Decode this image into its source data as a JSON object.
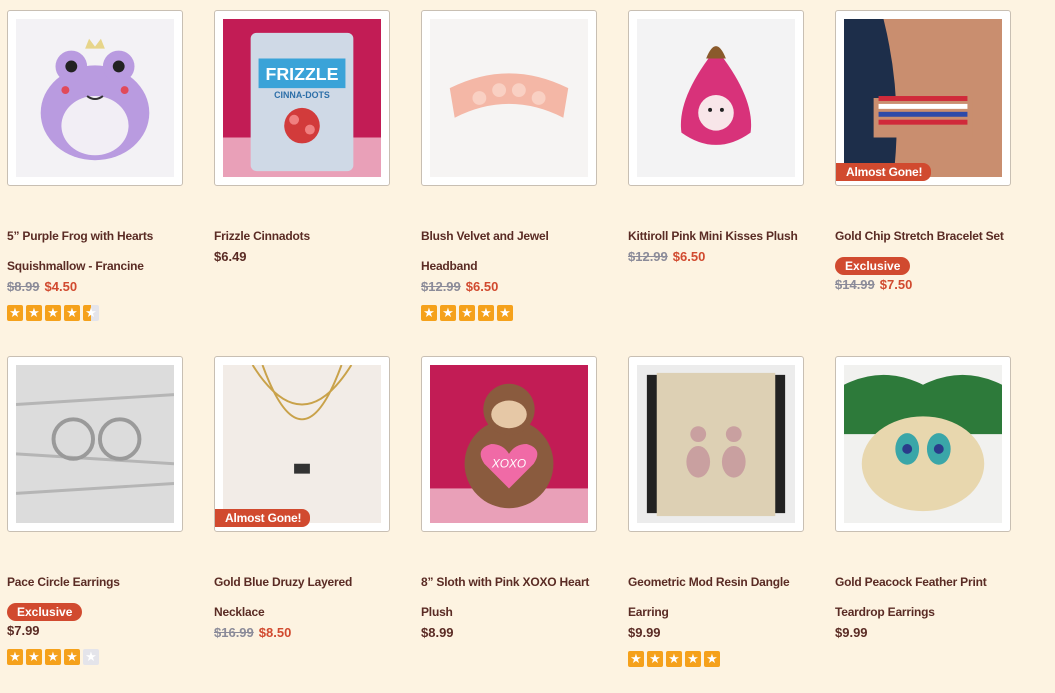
{
  "products": [
    {
      "name_lines": [
        "5” Purple Frog with Hearts",
        "Squishmallow - Francine"
      ],
      "old_price": "$8.99",
      "price": "$4.50",
      "rating": 4.5,
      "badge": "",
      "exclusive": ""
    },
    {
      "name_lines": [
        "Frizzle Cinnadots"
      ],
      "old_price": "",
      "price": "$6.49",
      "rating": 0,
      "badge": "",
      "exclusive": ""
    },
    {
      "name_lines": [
        "Blush Velvet and Jewel",
        "Headband"
      ],
      "old_price": "$12.99",
      "price": "$6.50",
      "rating": 5,
      "badge": "",
      "exclusive": ""
    },
    {
      "name_lines": [
        "Kittiroll Pink Mini Kisses Plush"
      ],
      "old_price": "$12.99",
      "price": "$6.50",
      "rating": 0,
      "badge": "",
      "exclusive": ""
    },
    {
      "name_lines": [
        "Gold Chip Stretch Bracelet Set"
      ],
      "old_price": "$14.99",
      "price": "$7.50",
      "rating": 0,
      "badge": "Almost Gone!",
      "exclusive": "Exclusive"
    },
    {
      "name_lines": [
        "Pace Circle Earrings"
      ],
      "old_price": "",
      "price": "$7.99",
      "rating": 4,
      "badge": "",
      "exclusive": "Exclusive"
    },
    {
      "name_lines": [
        "Gold Blue Druzy Layered",
        "Necklace"
      ],
      "old_price": "$16.99",
      "price": "$8.50",
      "rating": 0,
      "badge": "Almost Gone!",
      "exclusive": ""
    },
    {
      "name_lines": [
        "8” Sloth with Pink XOXO Heart",
        "Plush"
      ],
      "old_price": "",
      "price": "$8.99",
      "rating": 0,
      "badge": "",
      "exclusive": ""
    },
    {
      "name_lines": [
        "Geometric Mod Resin Dangle",
        "Earring"
      ],
      "old_price": "",
      "price": "$9.99",
      "rating": 5,
      "badge": "",
      "exclusive": ""
    },
    {
      "name_lines": [
        "Gold Peacock Feather Print",
        "Teardrop Earrings"
      ],
      "old_price": "",
      "price": "$9.99",
      "rating": 0,
      "badge": "",
      "exclusive": ""
    }
  ],
  "colors": {
    "background": "#fdf3e1",
    "sale": "#d14a2f",
    "title": "#5a2b24",
    "star": "#f5a11b"
  },
  "package_label": "FRIZZLE",
  "package_sub": "CINNA-DOTS",
  "plush_text": "XOXO"
}
